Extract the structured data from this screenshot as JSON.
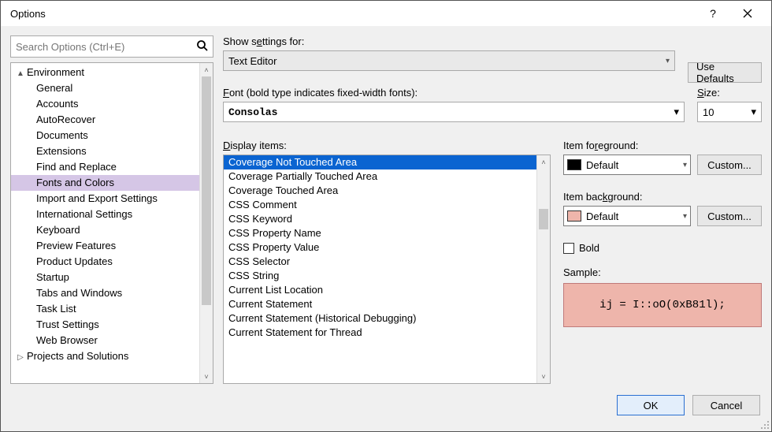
{
  "window": {
    "title": "Options"
  },
  "search": {
    "placeholder": "Search Options (Ctrl+E)"
  },
  "tree": {
    "items": [
      {
        "label": "Environment",
        "level": 1,
        "twisty": "▲",
        "selected": false
      },
      {
        "label": "General",
        "level": 2,
        "selected": false
      },
      {
        "label": "Accounts",
        "level": 2,
        "selected": false
      },
      {
        "label": "AutoRecover",
        "level": 2,
        "selected": false
      },
      {
        "label": "Documents",
        "level": 2,
        "selected": false
      },
      {
        "label": "Extensions",
        "level": 2,
        "selected": false
      },
      {
        "label": "Find and Replace",
        "level": 2,
        "selected": false
      },
      {
        "label": "Fonts and Colors",
        "level": 2,
        "selected": true
      },
      {
        "label": "Import and Export Settings",
        "level": 2,
        "selected": false
      },
      {
        "label": "International Settings",
        "level": 2,
        "selected": false
      },
      {
        "label": "Keyboard",
        "level": 2,
        "selected": false
      },
      {
        "label": "Preview Features",
        "level": 2,
        "selected": false
      },
      {
        "label": "Product Updates",
        "level": 2,
        "selected": false
      },
      {
        "label": "Startup",
        "level": 2,
        "selected": false
      },
      {
        "label": "Tabs and Windows",
        "level": 2,
        "selected": false
      },
      {
        "label": "Task List",
        "level": 2,
        "selected": false
      },
      {
        "label": "Trust Settings",
        "level": 2,
        "selected": false
      },
      {
        "label": "Web Browser",
        "level": 2,
        "selected": false
      },
      {
        "label": "Projects and Solutions",
        "level": 1,
        "twisty": "▷",
        "selected": false
      }
    ]
  },
  "settings": {
    "show_settings_label": "Show settings for:",
    "show_settings_value": "Text Editor",
    "use_defaults": "Use Defaults",
    "font_label": "Font (bold type indicates fixed-width fonts):",
    "font_value": "Consolas",
    "size_label": "Size:",
    "size_value": "10",
    "display_items_label": "Display items:",
    "display_items": [
      "Coverage Not Touched Area",
      "Coverage Partially Touched Area",
      "Coverage Touched Area",
      "CSS Comment",
      "CSS Keyword",
      "CSS Property Name",
      "CSS Property Value",
      "CSS Selector",
      "CSS String",
      "Current List Location",
      "Current Statement",
      "Current Statement (Historical Debugging)",
      "Current Statement for Thread"
    ],
    "display_selected_index": 0,
    "item_fg_label": "Item foreground:",
    "item_fg_value": "Default",
    "item_fg_swatch": "#000000",
    "item_bg_label": "Item background:",
    "item_bg_value": "Default",
    "item_bg_swatch": "#eeb5ab",
    "custom_label": "Custom...",
    "bold_label": "Bold",
    "sample_label": "Sample:",
    "sample_text": "ij = I::oO(0xB81l);"
  },
  "footer": {
    "ok": "OK",
    "cancel": "Cancel"
  }
}
